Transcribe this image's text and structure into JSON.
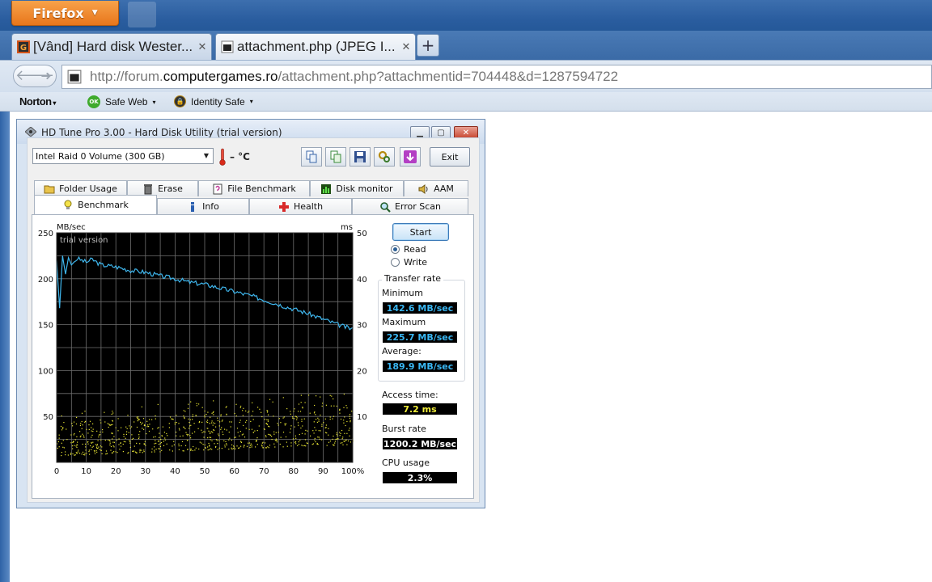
{
  "browser": {
    "menu_button": "Firefox",
    "tabs": [
      {
        "title": "[Vând] Hard disk Wester...",
        "active": false
      },
      {
        "title": "attachment.php (JPEG I...",
        "active": true
      }
    ],
    "new_tab": "+",
    "url_prefix": "http://forum.",
    "url_domain": "computergames.ro",
    "url_rest": "/attachment.php?attachmentid=704448&d=1287594722",
    "norton_label": "Norton",
    "safe_web_label": "Safe Web",
    "safe_web_badge": "OK",
    "identity_safe_label": "Identity Safe"
  },
  "hdtune": {
    "window_title": "HD Tune Pro 3.00 - Hard Disk Utility (trial version)",
    "drive": "Intel   Raid 0 Volume (300 GB)",
    "temperature": "– °C",
    "exit_label": "Exit",
    "tabs_row1": [
      "Folder Usage",
      "Erase",
      "File Benchmark",
      "Disk monitor",
      "AAM"
    ],
    "tabs_row2": [
      "Benchmark",
      "Info",
      "Health",
      "Error Scan"
    ],
    "start_label": "Start",
    "read_label": "Read",
    "write_label": "Write",
    "transfer_rate_label": "Transfer rate",
    "minimum_label": "Minimum",
    "minimum_value": "142.6 MB/sec",
    "maximum_label": "Maximum",
    "maximum_value": "225.7 MB/sec",
    "average_label": "Average:",
    "average_value": "189.9 MB/sec",
    "access_time_label": "Access time:",
    "access_time_value": "7.2 ms",
    "burst_rate_label": "Burst rate",
    "burst_rate_value": "1200.2 MB/sec",
    "cpu_usage_label": "CPU usage",
    "cpu_usage_value": "2.3%"
  },
  "chart_data": {
    "type": "line",
    "watermark": "trial version",
    "y_left_label": "MB/sec",
    "y_right_label": "ms",
    "y_left_ticks": [
      "250",
      "200",
      "150",
      "100",
      "50"
    ],
    "y_right_ticks": [
      "50",
      "40",
      "30",
      "20",
      "10"
    ],
    "x_ticks": [
      "0",
      "10",
      "20",
      "30",
      "40",
      "50",
      "60",
      "70",
      "80",
      "90",
      "100%"
    ],
    "ylim_left": [
      0,
      250
    ],
    "ylim_right": [
      0,
      50
    ],
    "xlim": [
      0,
      100
    ],
    "colors": {
      "transfer": "#3fb7ee",
      "access": "#e8e534",
      "grid": "#6f6f6f",
      "bg": "#000000"
    },
    "series": [
      {
        "name": "Transfer rate",
        "axis": "left",
        "x": [
          0,
          1,
          2,
          3,
          4,
          5,
          7,
          10,
          12,
          15,
          20,
          25,
          30,
          35,
          40,
          45,
          50,
          55,
          60,
          65,
          70,
          75,
          80,
          85,
          90,
          95,
          98,
          100
        ],
        "y": [
          220,
          168,
          225,
          205,
          223,
          215,
          222,
          218,
          221,
          215,
          213,
          209,
          207,
          203,
          200,
          196,
          194,
          190,
          186,
          182,
          177,
          172,
          167,
          162,
          156,
          150,
          147,
          145
        ]
      },
      {
        "name": "Access time",
        "axis": "right",
        "type": "scatter",
        "x_range": [
          0,
          100
        ],
        "y_band_start": [
          1.5,
          9
        ],
        "y_band_end": [
          4,
          13
        ],
        "count": 800
      }
    ]
  }
}
